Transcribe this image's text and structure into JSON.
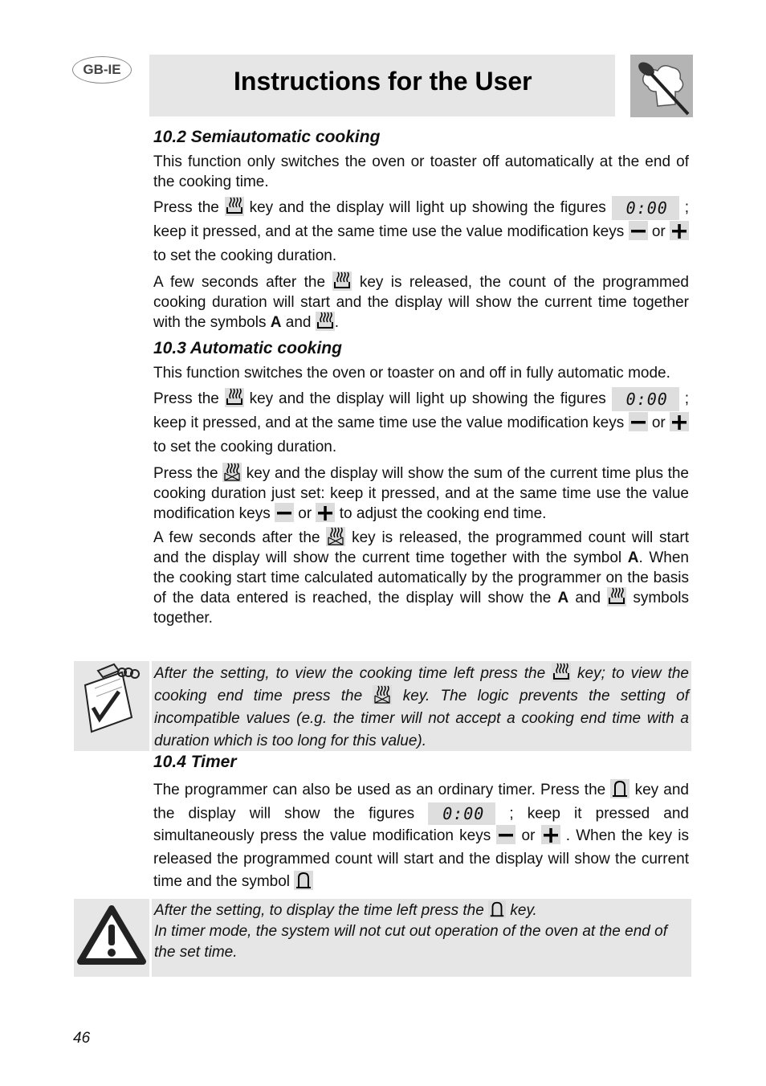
{
  "header": {
    "lang_badge": "GB-IE",
    "title": "Instructions for the User",
    "logo_icon": "chef-hat-spoon-icon"
  },
  "display_figures": "0:00",
  "keys": {
    "duration": "duration-key-icon",
    "end_time": "end-time-key-icon",
    "timer": "bell-key-icon",
    "minus": "minus-key-icon",
    "plus": "plus-key-icon"
  },
  "s102": {
    "heading": "10.2   Semiautomatic cooking",
    "p1": "This function only switches the oven or toaster off automatically at the end of the cooking time.",
    "p2a": "Press the ",
    "p2b": " key and the display will light up showing the figures ",
    "p2c": " ; keep it pressed, and at the same time use the value modification keys ",
    "p2d": " or ",
    "p2e": " to set the cooking duration.",
    "p3a": "A few seconds after the ",
    "p3b": " key is released, the count of the programmed cooking duration will start and the display will show the current time together with the symbols ",
    "p3A": "A",
    "p3c": " and ",
    "p3d": "."
  },
  "s103": {
    "heading": "10.3   Automatic cooking",
    "p1": "This function switches the oven or toaster on and off in fully automatic mode.",
    "p2a": "Press the ",
    "p2b": " key and the display will light up showing the figures ",
    "p2c": " ; keep it pressed, and at the same time use the value modification keys ",
    "p2d": " or ",
    "p2e": " to set the cooking duration.",
    "p3a": "Press the ",
    "p3b": " key and the display will show the sum of the current time plus the cooking duration just set: keep it pressed, and at the same time use the value modification keys ",
    "p3c": " or ",
    "p3d": " to adjust the cooking end time.",
    "p4a": "A few seconds after the ",
    "p4b": " key is released, the programmed count will start and the display will show the current time together with the symbol ",
    "p4A": "A",
    "p4c": ". When the cooking start time calculated automatically by the programmer on the basis of the data entered is reached, the display will show the ",
    "p4A2": "A",
    "p4d": " and ",
    "p4e": " symbols together."
  },
  "note1": {
    "icon": "notepad-check-icon",
    "a": "After the setting, to view the cooking time left press the ",
    "b": " key; to view the cooking end time press the ",
    "c": " key. The logic prevents the setting of incompatible values (e.g. the timer will not accept a cooking end time with a duration which is too long for this value)."
  },
  "s104": {
    "heading": "10.4   Timer",
    "p1a": "The programmer can also be used as an ordinary timer. Press the ",
    "p1b": " key and the display will show the figures ",
    "p1c": " ; keep it pressed and simultaneously press the value modification keys ",
    "p1d": " or ",
    "p1e": " . When the key is released the programmed count will start and the display will show the current time and the symbol "
  },
  "warning": {
    "icon": "warning-triangle-icon",
    "a": "After the setting, to display the time left press the ",
    "b": " key.",
    "line2": "In timer mode, the system will not cut out operation of the oven at the end of the set time."
  },
  "page_number": "46"
}
